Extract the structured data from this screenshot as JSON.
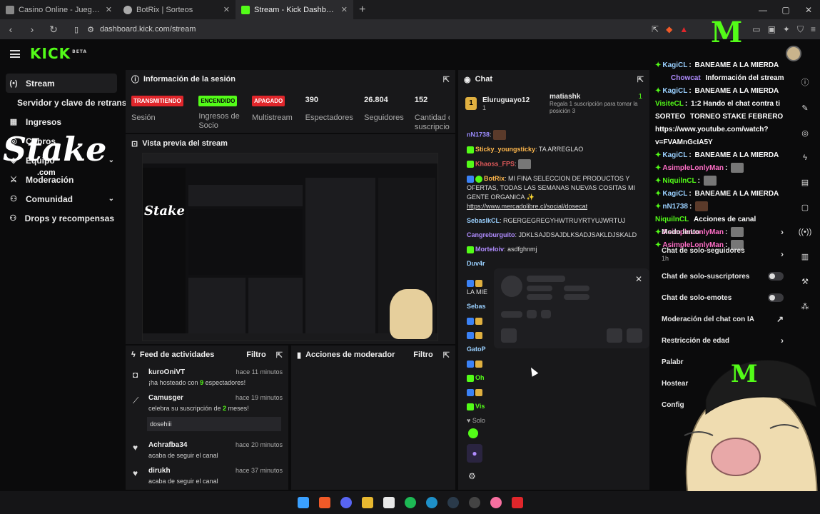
{
  "browser": {
    "tabs": [
      {
        "title": "Casino Online - Juegos de Casino en",
        "color": "#888"
      },
      {
        "title": "BotRix | Sorteos",
        "color": "#aaa"
      },
      {
        "title": "Stream - Kick Dashboard",
        "color": "#53fc18"
      }
    ],
    "new_tab": "+",
    "url": "dashboard.kick.com/stream"
  },
  "kick": {
    "logo": "KICK",
    "beta": "BETA"
  },
  "sidebar": {
    "items": [
      {
        "label": "Stream",
        "icon": "(•)"
      },
      {
        "label": "Servidor y clave de retransm",
        "icon": ""
      },
      {
        "label": "Ingresos",
        "icon": "▦"
      },
      {
        "label": "Cobros",
        "icon": "◎"
      },
      {
        "label": "Equipo",
        "icon": "◈"
      },
      {
        "label": "Moderación",
        "icon": "⚔"
      },
      {
        "label": "Comunidad",
        "icon": "⚇"
      },
      {
        "label": "Drops y recompensas",
        "icon": "⚇"
      }
    ],
    "overlay_logo": "Stake",
    "overlay_logo_sub": ".com"
  },
  "session": {
    "title": "Información de la sesión",
    "stats": [
      {
        "badge": "TRANSMITIENDO",
        "badge_color": "#e0262b",
        "label": "Sesión"
      },
      {
        "badge": "ENCENDIDO",
        "badge_color": "#53fc18",
        "label": "Ingresos de Socio"
      },
      {
        "badge": "APAGADO",
        "badge_color": "#e0262b",
        "label": "Multistream"
      },
      {
        "num": "390",
        "label": "Espectadores"
      },
      {
        "num": "26.804",
        "label": "Seguidores"
      },
      {
        "num": "152",
        "label": "Cantidad de suscripciones"
      }
    ]
  },
  "preview": {
    "title": "Vista previa del stream"
  },
  "feed": {
    "title": "Feed de actividades",
    "filter": "Filtro",
    "items": [
      {
        "user": "kuroOniVT",
        "time": "hace 11 minutos",
        "pre": "¡ha hosteado con ",
        "hl": "9",
        "post": " espectadores!"
      },
      {
        "user": "Camusger",
        "time": "hace 19 minutos",
        "pre": "celebra su suscripción de ",
        "hl": "2",
        "post": " meses!",
        "msg": "dosehiii"
      },
      {
        "user": "Achrafba34",
        "time": "hace 20 minutos",
        "pre": "acaba de seguir el canal",
        "hl": "",
        "post": ""
      },
      {
        "user": "dirukh",
        "time": "hace 37 minutos",
        "pre": "acaba de seguir el canal",
        "hl": "",
        "post": ""
      }
    ]
  },
  "modactions": {
    "title": "Acciones de moderador",
    "filter": "Filtro"
  },
  "chat": {
    "title": "Chat",
    "pinned": {
      "user": "Eluruguayo12",
      "count": "1",
      "target": "matiashk",
      "count2": "1",
      "note": "Regala 1 suscripción para tomar la posición 3"
    },
    "messages": [
      {
        "user": "nN1738",
        "color": "#9b8cff",
        "text": ""
      },
      {
        "user": "Sticky_youngsticky",
        "color": "#ffb84d",
        "text": "TA ARREGLAO"
      },
      {
        "user": "Khaoss_FPS",
        "color": "#e05a5a",
        "text": ""
      },
      {
        "user": "BotRix",
        "color": "#ffb84d",
        "text": "MI FINA SELECCION DE PRODUCTOS Y OFERTAS, TODAS LAS SEMANAS NUEVAS COSITAS MI GENTE ORGANICA ✨",
        "link": "https://www.mercadolibre.cl/social/dosecat"
      },
      {
        "user": "SebaslkCL",
        "color": "#9ad0ff",
        "text": "RGERGEGREGYHWTRUYRTYUJWRTUJ"
      },
      {
        "user": "Cangreburguito",
        "color": "#b08cff",
        "text": "JDKLSAJDSAJDLKSADJSAKLDJSKALD"
      },
      {
        "user": "Morteloiv",
        "color": "#b08cff",
        "text": "asdfghnmj"
      }
    ],
    "partial_users": [
      "Duv4r",
      "LA MIE",
      "Sebas",
      "GatoP",
      "Oh",
      "Vis",
      "Solo"
    ]
  },
  "right_chat": {
    "lines": [
      {
        "user": "KagiCL",
        "text": "BANEAME A LA MIERDA"
      },
      {
        "user": "Chowcat",
        "text": "Información del stream"
      },
      {
        "user": "KagiCL",
        "text": "BANEAME A LA MIERDA"
      },
      {
        "user": "VisiteCL",
        "text": "1:2 Hando el chat contra ti"
      },
      {
        "user": "SORTEO",
        "text": "TORNEO STAKE FEBRERO"
      },
      {
        "user": "https://www.youtube.com/watch?",
        "text": ""
      },
      {
        "user": "v=FVAMnGcIA5Y",
        "text": ""
      },
      {
        "user": "KagiCL",
        "text": "BANEAME A LA MIERDA"
      },
      {
        "user": "AsimpleLonlyMan",
        "text": ""
      },
      {
        "user": "NiquilnCL",
        "text": ""
      },
      {
        "user": "KagiCL",
        "text": "BANEAME A LA MIERDA"
      },
      {
        "user": "nN1738",
        "text": ""
      },
      {
        "user": "NiquilnCL",
        "text": "Acciones de canal"
      },
      {
        "user": "AsimpleLonlyMan",
        "text": ""
      },
      {
        "user": "AsimpleLonlyMan",
        "text": ""
      }
    ]
  },
  "mod_settings": {
    "items": [
      {
        "label": "Modo lento",
        "ctl": "›"
      },
      {
        "label": "Chat de solo-seguidores",
        "sub": "1h",
        "ctl": "›"
      },
      {
        "label": "Chat de solo-suscriptores",
        "ctl": "toggle"
      },
      {
        "label": "Chat de solo-emotes",
        "ctl": "toggle"
      },
      {
        "label": "Moderación del chat con IA",
        "ctl": "↗"
      },
      {
        "label": "Restricción de edad",
        "ctl": "›"
      },
      {
        "label": "Palabr",
        "ctl": ""
      },
      {
        "label": "Hostear",
        "ctl": ""
      },
      {
        "label": "Config",
        "ctl": ""
      }
    ]
  },
  "taskbar": {
    "icons": [
      "windows-icon",
      "brave-icon",
      "discord-icon",
      "folder-icon",
      "media-icon",
      "spotify-icon",
      "edge-icon",
      "steam-icon",
      "obs-icon",
      "itunes-icon",
      "kick-icon"
    ]
  }
}
